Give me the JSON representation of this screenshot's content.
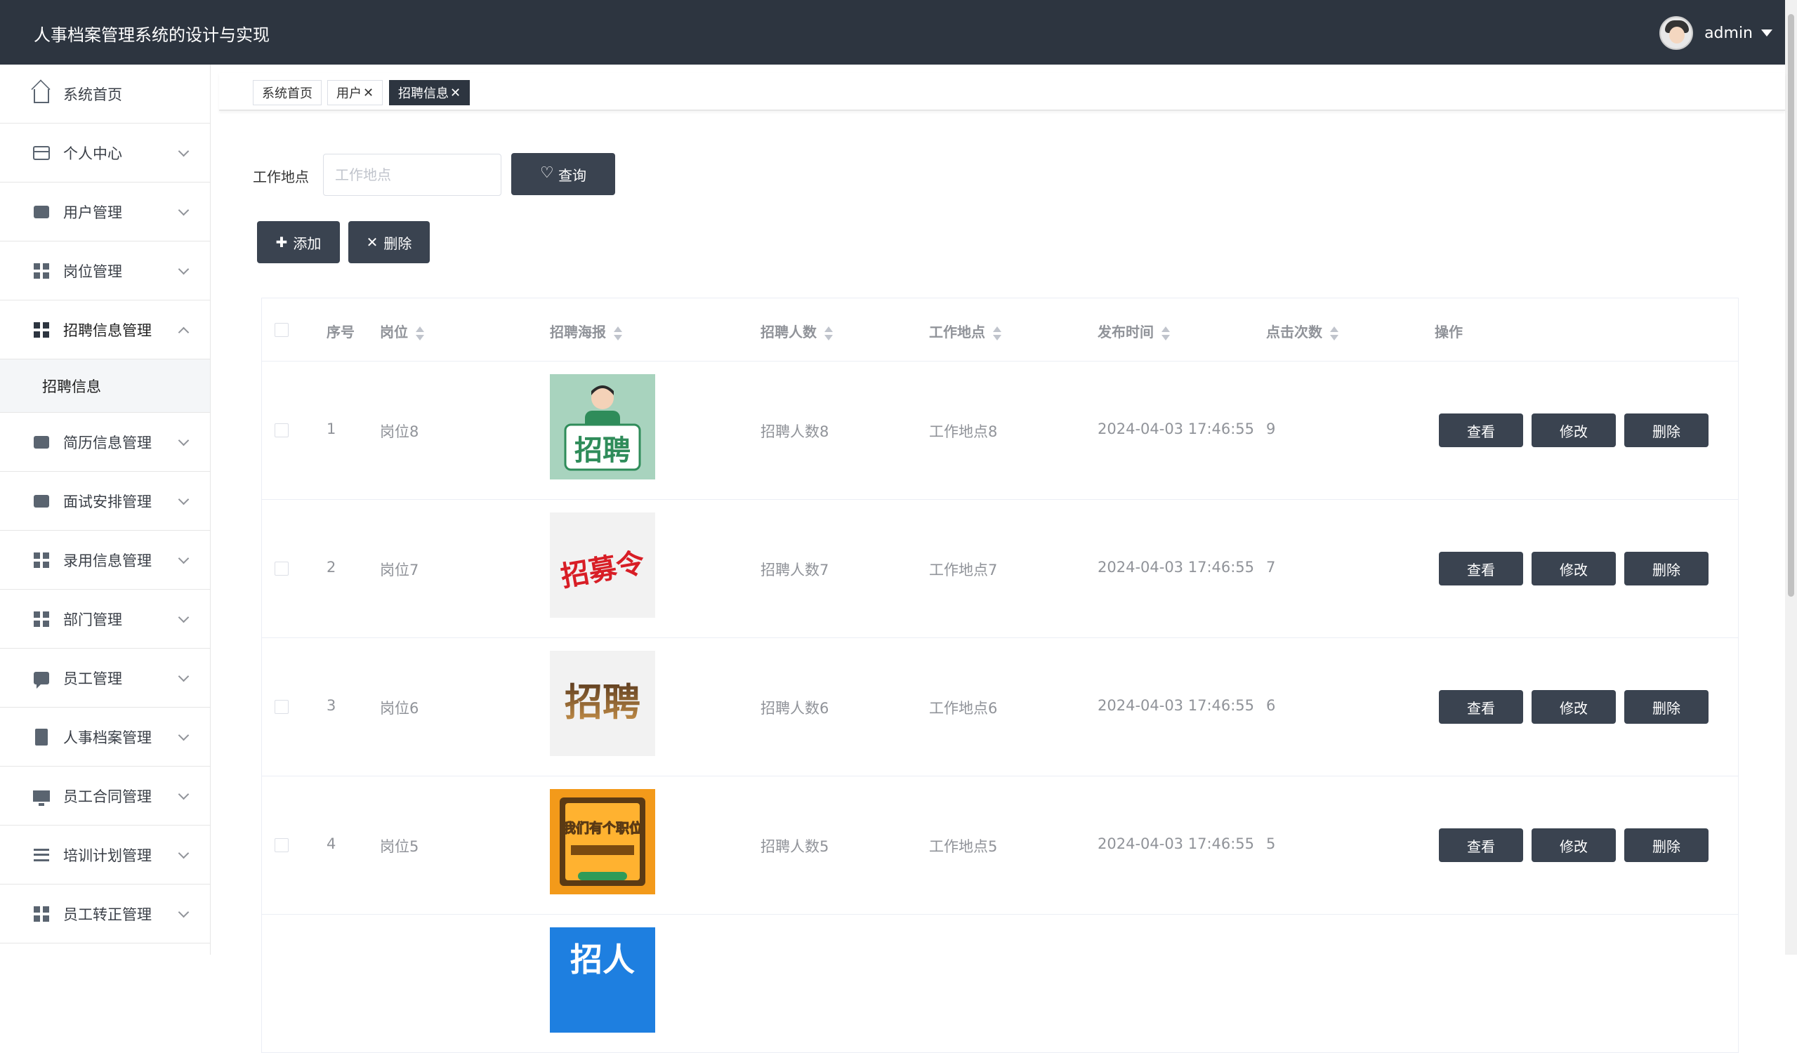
{
  "app": {
    "title": "人事档案管理系统的设计与实现"
  },
  "user": {
    "name": "admin"
  },
  "sidebar": {
    "items": [
      {
        "label": "系统首页"
      },
      {
        "label": "个人中心"
      },
      {
        "label": "用户管理"
      },
      {
        "label": "岗位管理"
      },
      {
        "label": "招聘信息管理"
      },
      {
        "label": "简历信息管理"
      },
      {
        "label": "面试安排管理"
      },
      {
        "label": "录用信息管理"
      },
      {
        "label": "部门管理"
      },
      {
        "label": "员工管理"
      },
      {
        "label": "人事档案管理"
      },
      {
        "label": "员工合同管理"
      },
      {
        "label": "培训计划管理"
      },
      {
        "label": "员工转正管理"
      }
    ],
    "submenu": {
      "label": "招聘信息"
    }
  },
  "tabs": [
    {
      "label": "系统首页"
    },
    {
      "label": "用户"
    },
    {
      "label": "招聘信息"
    }
  ],
  "tab_close": "✕",
  "search": {
    "label": "工作地点",
    "placeholder": "工作地点",
    "button": "查询"
  },
  "toolbar": {
    "add": "添加",
    "delete": "删除",
    "add_icon": "✚",
    "delete_icon": "✕"
  },
  "table": {
    "headers": [
      "序号",
      "岗位",
      "招聘海报",
      "招聘人数",
      "工作地点",
      "发布时间",
      "点击次数",
      "操作"
    ],
    "actions": {
      "view": "查看",
      "edit": "修改",
      "delete": "删除"
    },
    "rows": [
      {
        "index": "1",
        "position": "岗位8",
        "poster_text": "招聘",
        "count": "招聘人数8",
        "location": "工作地点8",
        "time": "2024-04-03 17:46:55",
        "clicks": "9"
      },
      {
        "index": "2",
        "position": "岗位7",
        "poster_text": "招募令",
        "count": "招聘人数7",
        "location": "工作地点7",
        "time": "2024-04-03 17:46:55",
        "clicks": "7"
      },
      {
        "index": "3",
        "position": "岗位6",
        "poster_text": "招聘",
        "count": "招聘人数6",
        "location": "工作地点6",
        "time": "2024-04-03 17:46:55",
        "clicks": "6"
      },
      {
        "index": "4",
        "position": "岗位5",
        "poster_text": "我们有个职位",
        "count": "招聘人数5",
        "location": "工作地点5",
        "time": "2024-04-03 17:46:55",
        "clicks": "5"
      },
      {
        "poster_text": "招人"
      }
    ]
  },
  "colors": {
    "header_bg": "#2d3540",
    "button_bg": "#3a4350",
    "muted_text": "#909399"
  }
}
